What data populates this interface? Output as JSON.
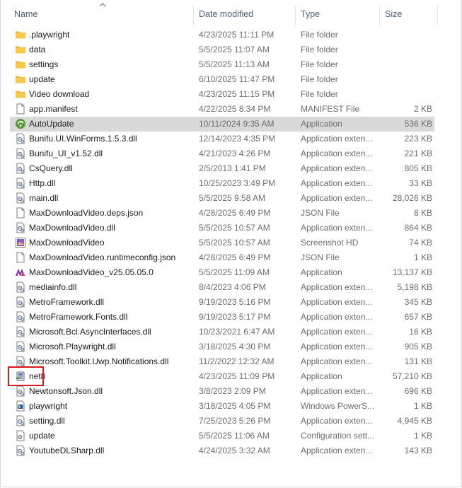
{
  "columns": {
    "name": "Name",
    "date": "Date modified",
    "type": "Type",
    "size": "Size"
  },
  "files": [
    {
      "name": ".playwright",
      "date": "4/23/2025 11:11 PM",
      "type": "File folder",
      "size": "",
      "icon": "folder-icon"
    },
    {
      "name": "data",
      "date": "5/5/2025 11:07 AM",
      "type": "File folder",
      "size": "",
      "icon": "folder-icon"
    },
    {
      "name": "settings",
      "date": "5/5/2025 11:13 AM",
      "type": "File folder",
      "size": "",
      "icon": "folder-icon"
    },
    {
      "name": "update",
      "date": "6/10/2025 11:47 PM",
      "type": "File folder",
      "size": "",
      "icon": "folder-icon"
    },
    {
      "name": "Video download",
      "date": "4/23/2025 11:15 PM",
      "type": "File folder",
      "size": "",
      "icon": "folder-icon"
    },
    {
      "name": "app.manifest",
      "date": "4/22/2025 8:34 PM",
      "type": "MANIFEST File",
      "size": "2 KB",
      "icon": "document-icon"
    },
    {
      "name": "AutoUpdate",
      "date": "10/11/2024 9:35 AM",
      "type": "Application",
      "size": "536 KB",
      "icon": "autoupdate-app-icon",
      "selected": true
    },
    {
      "name": "Bunifu.UI.WinForms.1.5.3.dll",
      "date": "12/14/2023 4:35 PM",
      "type": "Application exten...",
      "size": "223 KB",
      "icon": "dll-icon"
    },
    {
      "name": "Bunifu_UI_v1.52.dll",
      "date": "4/21/2023 4:26 PM",
      "type": "Application exten...",
      "size": "221 KB",
      "icon": "dll-icon"
    },
    {
      "name": "CsQuery.dll",
      "date": "2/5/2013 1:41 PM",
      "type": "Application exten...",
      "size": "805 KB",
      "icon": "dll-icon"
    },
    {
      "name": "Http.dll",
      "date": "10/25/2023 3:49 PM",
      "type": "Application exten...",
      "size": "33 KB",
      "icon": "dll-icon"
    },
    {
      "name": "main.dll",
      "date": "5/5/2025 9:58 AM",
      "type": "Application exten...",
      "size": "28,026 KB",
      "icon": "dll-icon"
    },
    {
      "name": "MaxDownloadVideo.deps.json",
      "date": "4/28/2025 6:49 PM",
      "type": "JSON File",
      "size": "8 KB",
      "icon": "document-icon"
    },
    {
      "name": "MaxDownloadVideo.dll",
      "date": "5/5/2025 10:57 AM",
      "type": "Application exten...",
      "size": "864 KB",
      "icon": "dll-icon"
    },
    {
      "name": "MaxDownloadVideo",
      "date": "5/5/2025 10:57 AM",
      "type": "Screenshot HD",
      "size": "74 KB",
      "icon": "screenshot-icon"
    },
    {
      "name": "MaxDownloadVideo.runtimeconfig.json",
      "date": "4/28/2025 6:49 PM",
      "type": "JSON File",
      "size": "1 KB",
      "icon": "document-icon"
    },
    {
      "name": "MaxDownloadVideo_v25.05.05.0",
      "date": "5/5/2025 11:09 AM",
      "type": "Application",
      "size": "13,137 KB",
      "icon": "maxdownload-app-icon"
    },
    {
      "name": "mediainfo.dll",
      "date": "8/4/2023 4:06 PM",
      "type": "Application exten...",
      "size": "5,198 KB",
      "icon": "dll-icon"
    },
    {
      "name": "MetroFramework.dll",
      "date": "9/19/2023 5:16 PM",
      "type": "Application exten...",
      "size": "345 KB",
      "icon": "dll-icon"
    },
    {
      "name": "MetroFramework.Fonts.dll",
      "date": "9/19/2023 5:17 PM",
      "type": "Application exten...",
      "size": "657 KB",
      "icon": "dll-icon"
    },
    {
      "name": "Microsoft.Bcl.AsyncInterfaces.dll",
      "date": "10/23/2021 6:47 AM",
      "type": "Application exten...",
      "size": "16 KB",
      "icon": "dll-icon"
    },
    {
      "name": "Microsoft.Playwright.dll",
      "date": "3/18/2025 4:30 PM",
      "type": "Application exten...",
      "size": "905 KB",
      "icon": "dll-icon"
    },
    {
      "name": "Microsoft.Toolkit.Uwp.Notifications.dll",
      "date": "11/2/2022 12:32 AM",
      "type": "Application exten...",
      "size": "131 KB",
      "icon": "dll-icon"
    },
    {
      "name": "net8",
      "date": "4/23/2025 11:09 PM",
      "type": "Application",
      "size": "57,210 KB",
      "icon": "installer-app-icon"
    },
    {
      "name": "Newtonsoft.Json.dll",
      "date": "3/8/2023 2:09 PM",
      "type": "Application exten...",
      "size": "696 KB",
      "icon": "dll-icon"
    },
    {
      "name": "playwright",
      "date": "3/18/2025 4:05 PM",
      "type": "Windows PowerS...",
      "size": "1 KB",
      "icon": "powershell-script-icon"
    },
    {
      "name": "setting.dll",
      "date": "7/25/2023 5:26 PM",
      "type": "Application exten...",
      "size": "4,945 KB",
      "icon": "dll-icon"
    },
    {
      "name": "update",
      "date": "5/5/2025 11:06 AM",
      "type": "Configuration sett...",
      "size": "1 KB",
      "icon": "config-settings-icon"
    },
    {
      "name": "YoutubeDLSharp.dll",
      "date": "4/24/2025 3:32 AM",
      "type": "Application exten...",
      "size": "143 KB",
      "icon": "dll-icon"
    }
  ],
  "colors": {
    "highlight": "#e0161a",
    "selection": "#d9d9d9",
    "folder": "#f8c84a",
    "header_text": "#4c607a"
  }
}
